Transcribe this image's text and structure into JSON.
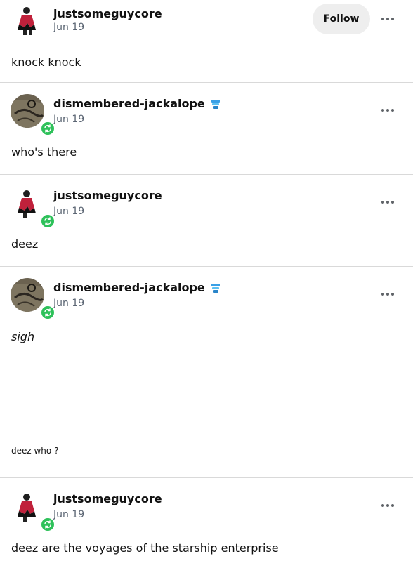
{
  "posts": [
    {
      "blog": "justsomeguycore",
      "date": "Jun 19",
      "text": "knock knock",
      "follow_label": "Follow"
    },
    {
      "blog": "dismembered-jackalope",
      "date": "Jun 19",
      "text": "who's there"
    },
    {
      "blog": "justsomeguycore",
      "date": "Jun 19",
      "text": "deez"
    },
    {
      "blog": "dismembered-jackalope",
      "date": "Jun 19",
      "text": "sigh",
      "small_text": "deez who ?"
    },
    {
      "blog": "justsomeguycore",
      "date": "Jun 19",
      "text": "deez are the voyages of the starship enterprise"
    }
  ],
  "colors": {
    "reblog_badge": "#2ec15a",
    "divider": "#d9d9d9",
    "follow_bg": "#eeeeee",
    "date_text": "#5b6573"
  },
  "icons": {
    "more": "more-options-icon",
    "reblog": "reblog-icon",
    "badge": "blue-badge-icon"
  }
}
